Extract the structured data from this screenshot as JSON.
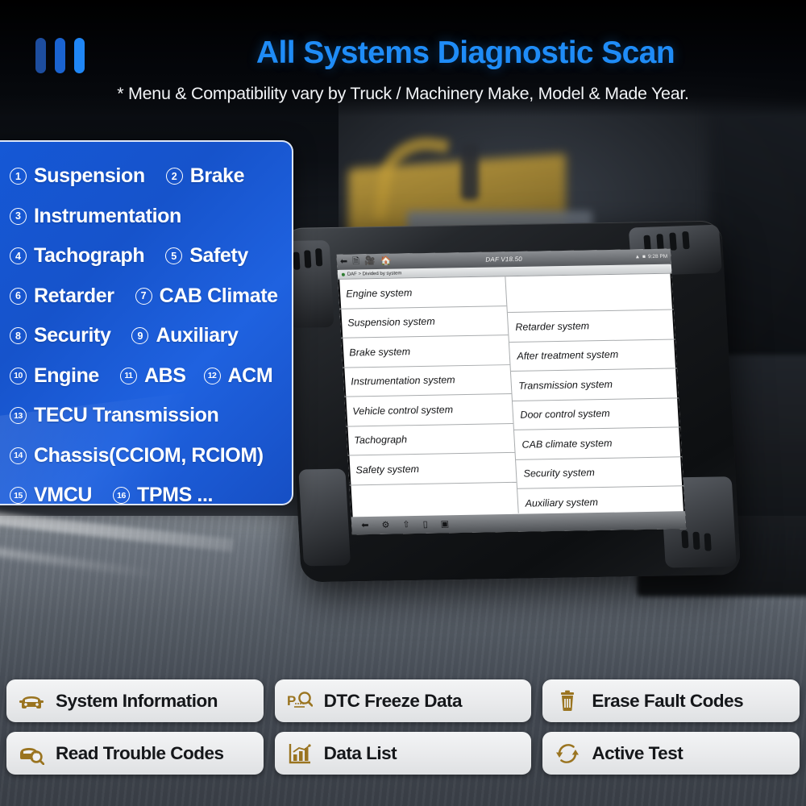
{
  "header": {
    "title": "All Systems Diagnostic Scan",
    "subtitle": "* Menu & Compatibility vary by Truck / Machinery Make, Model & Made Year.",
    "accent_color": "#1f8cf7"
  },
  "systems_panel": {
    "background_color": "#1653cb",
    "rows": [
      [
        {
          "num": "1",
          "label": "Suspension"
        },
        {
          "num": "2",
          "label": "Brake"
        }
      ],
      [
        {
          "num": "3",
          "label": "Instrumentation"
        }
      ],
      [
        {
          "num": "4",
          "label": "Tachograph"
        },
        {
          "num": "5",
          "label": "Safety"
        }
      ],
      [
        {
          "num": "6",
          "label": "Retarder"
        },
        {
          "num": "7",
          "label": "CAB Climate"
        }
      ],
      [
        {
          "num": "8",
          "label": "Security"
        },
        {
          "num": "9",
          "label": "Auxiliary"
        }
      ],
      [
        {
          "num": "10",
          "label": "Engine"
        },
        {
          "num": "11",
          "label": "ABS"
        },
        {
          "num": "12",
          "label": "ACM"
        }
      ],
      [
        {
          "num": "13",
          "label": "TECU Transmission"
        }
      ],
      [
        {
          "num": "14",
          "label": "Chassis(CCIOM, RCIOM)"
        }
      ],
      [
        {
          "num": "15",
          "label": "VMCU"
        },
        {
          "num": "16",
          "label": "TPMS ..."
        }
      ]
    ]
  },
  "tablet": {
    "titlebar": {
      "title": "DAF V18.50",
      "time": "9:28 PM",
      "nav_icons": [
        "back-arrow-icon",
        "clipboard-icon",
        "video-camera-icon",
        "home-icon"
      ],
      "status_icons": [
        "wifi-icon",
        "battery-icon",
        "edit-icon"
      ]
    },
    "breadcrumb": "DAF > Divided by system",
    "left_column": [
      "Engine system",
      "Suspension system",
      "Brake system",
      "Instrumentation system",
      "Vehicle control system",
      "Tachograph",
      "Safety system"
    ],
    "right_column": [
      "Retarder system",
      "After treatment system",
      "Transmission system",
      "Door control system",
      "CAB climate system",
      "Security system",
      "Auxiliary system"
    ],
    "bottom_icons": [
      "back-arrow-icon",
      "vci-icon",
      "home-icon",
      "file-icon",
      "screenshot-icon"
    ]
  },
  "functions": {
    "icon_color": "#9a7420",
    "buttons": [
      {
        "label": "System Information",
        "icon": "car-front-icon"
      },
      {
        "label": "DTC Freeze Data",
        "icon": "dtc-magnifier-icon"
      },
      {
        "label": "Erase Fault Codes",
        "icon": "trash-icon"
      },
      {
        "label": "Read Trouble Codes",
        "icon": "car-magnifier-icon"
      },
      {
        "label": "Data List",
        "icon": "bar-chart-icon"
      },
      {
        "label": "Active Test",
        "icon": "refresh-circle-icon"
      }
    ]
  }
}
